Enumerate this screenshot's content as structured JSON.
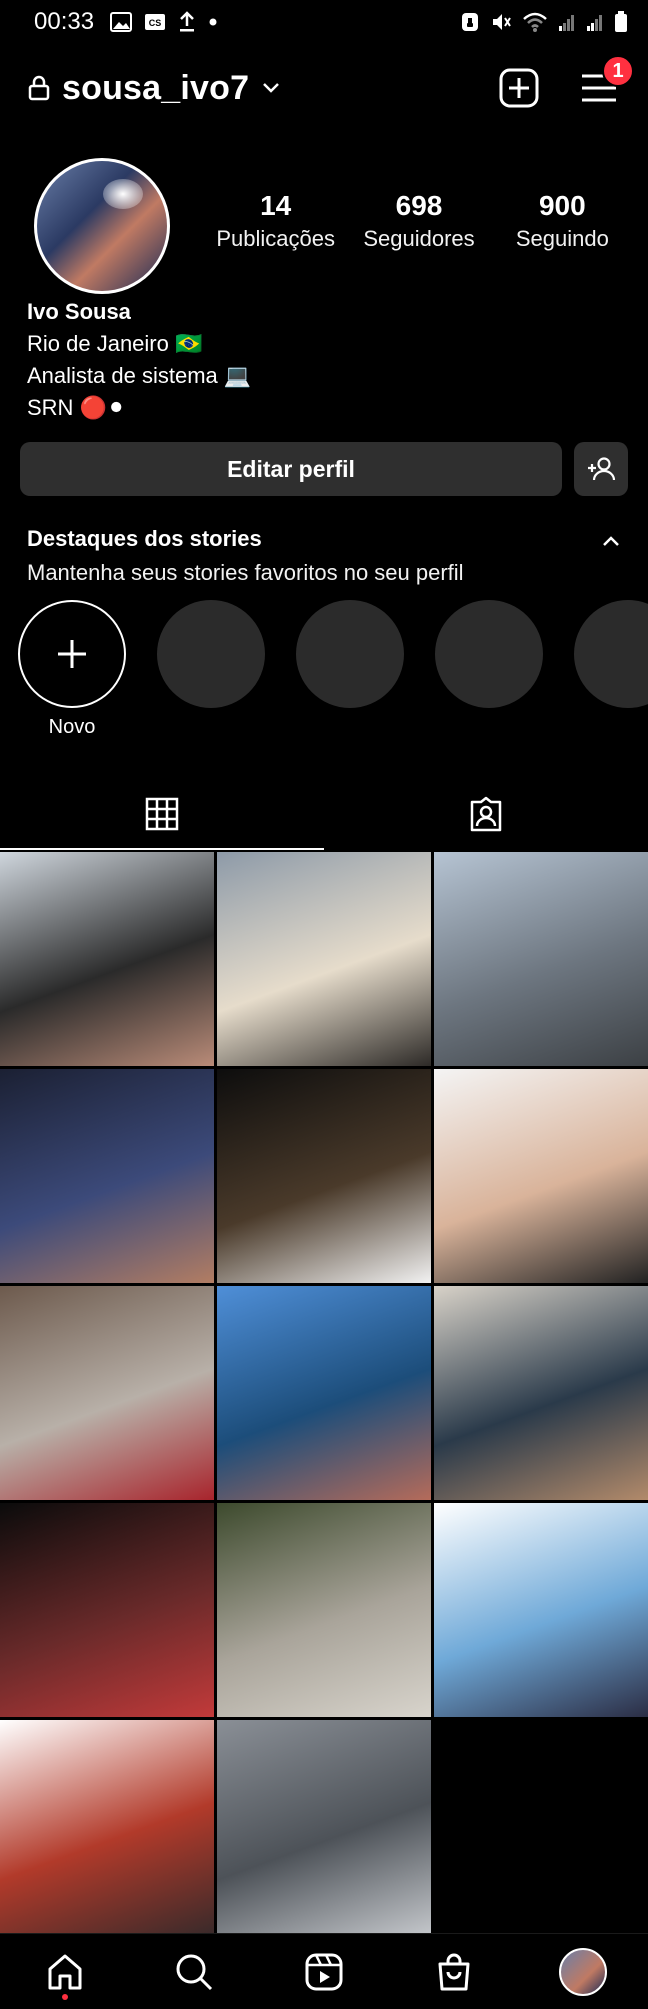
{
  "status_bar": {
    "time": "00:33",
    "left_icons": [
      "image-icon",
      "caption-icon",
      "upload-icon",
      "dot-icon"
    ],
    "right_icons": [
      "alarm-icon",
      "mute-icon",
      "wifi-icon",
      "signal-icon",
      "signal-icon",
      "battery-icon"
    ]
  },
  "header": {
    "username": "sousa_ivo7",
    "notification_count": "1"
  },
  "profile": {
    "stats": [
      {
        "number": "14",
        "label": "Publicações"
      },
      {
        "number": "698",
        "label": "Seguidores"
      },
      {
        "number": "900",
        "label": "Seguindo"
      }
    ],
    "bio": {
      "name": "Ivo Sousa",
      "line1": "Rio de Janeiro 🇧🇷",
      "line2": "Analista de sistema 💻",
      "line3": "SRN 🔴⚫"
    }
  },
  "actions": {
    "edit_profile": "Editar perfil"
  },
  "highlights": {
    "title": "Destaques dos stories",
    "subtitle": "Mantenha seus stories favoritos no seu perfil",
    "new_label": "Novo",
    "placeholder_count": 4
  },
  "tabs": [
    {
      "name": "grid",
      "active": true
    },
    {
      "name": "tagged",
      "active": false
    }
  ],
  "grid": {
    "posts": [
      {
        "colors": [
          "#cfd6dd",
          "#2a2a2a",
          "#b98b78"
        ]
      },
      {
        "colors": [
          "#8d9aa8",
          "#e6dccb",
          "#2d2a27"
        ]
      },
      {
        "colors": [
          "#b6c4d3",
          "#6d7680",
          "#3c4044"
        ]
      },
      {
        "colors": [
          "#1b2033",
          "#3c4a7a",
          "#b27d63"
        ]
      },
      {
        "colors": [
          "#0d0d0d",
          "#4a3a2a",
          "#f2f2f2"
        ]
      },
      {
        "colors": [
          "#f4f4f4",
          "#d9b39a",
          "#222222"
        ]
      },
      {
        "colors": [
          "#6d5a4d",
          "#b8b0a8",
          "#a8242c"
        ]
      },
      {
        "colors": [
          "#4f8fd8",
          "#1c4d7a",
          "#b56b5a"
        ]
      },
      {
        "colors": [
          "#d8d2c8",
          "#2a3a4a",
          "#b28a6a"
        ]
      },
      {
        "colors": [
          "#0b0b0b",
          "#6a2a2a",
          "#c23a3a"
        ]
      },
      {
        "colors": [
          "#3d4a2d",
          "#a9a49a",
          "#d8d4cc"
        ]
      },
      {
        "colors": [
          "#ffffff",
          "#6fa9d8",
          "#2b2d44"
        ]
      },
      {
        "colors": [
          "#ffffff",
          "#b23a2a",
          "#3a2a2a"
        ]
      },
      {
        "colors": [
          "#8a8f96",
          "#4d5258",
          "#c3c6ca"
        ]
      }
    ]
  },
  "bottom_nav": [
    "home-icon",
    "search-icon",
    "reels-icon",
    "shop-icon",
    "profile-avatar"
  ]
}
